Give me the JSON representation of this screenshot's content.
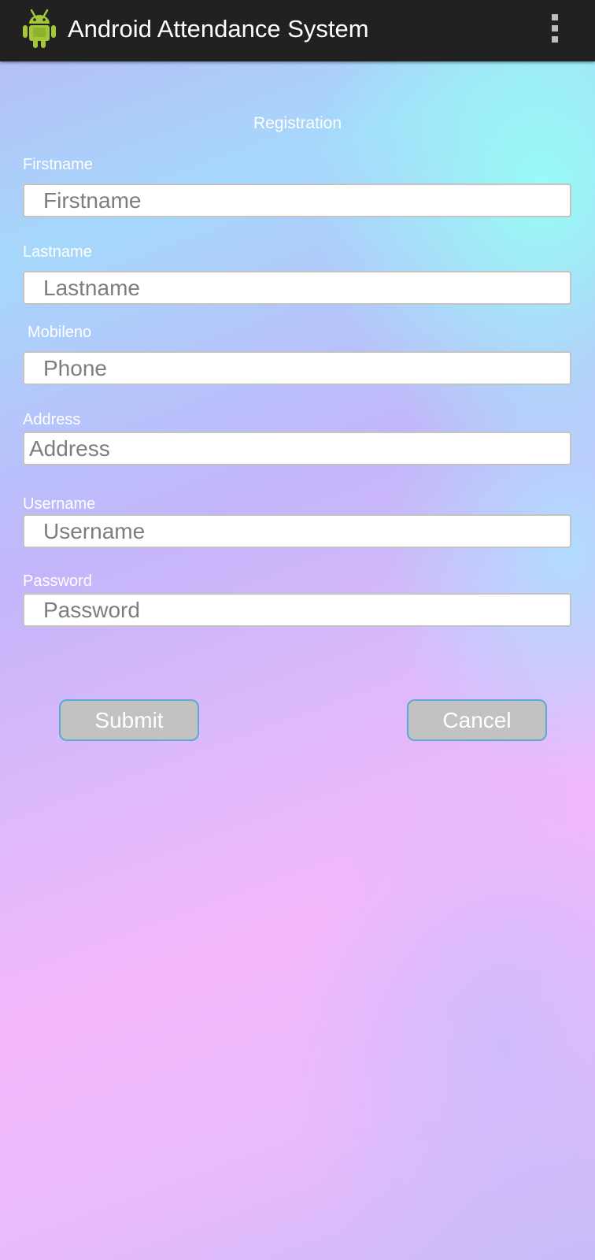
{
  "appbar": {
    "title": "Android Attendance System",
    "icon": "android-robot-icon",
    "menu_icon": "overflow-menu-icon",
    "background": "#212121"
  },
  "form": {
    "title": "Registration",
    "fields": [
      {
        "label": "Firstname",
        "placeholder": "Firstname",
        "value": ""
      },
      {
        "label": "Lastname",
        "placeholder": "Lastname",
        "value": ""
      },
      {
        "label": "Mobileno",
        "placeholder": "Phone",
        "value": ""
      },
      {
        "label": "Address",
        "placeholder": "Address",
        "value": ""
      },
      {
        "label": "Username",
        "placeholder": "Username",
        "value": ""
      },
      {
        "label": "Password",
        "placeholder": "Password",
        "value": ""
      }
    ],
    "buttons": {
      "submit": "Submit",
      "cancel": "Cancel"
    }
  },
  "colors": {
    "button_bg": "#c2c2c2",
    "button_border": "#5aa9d6",
    "label_text": "#ffffff"
  }
}
